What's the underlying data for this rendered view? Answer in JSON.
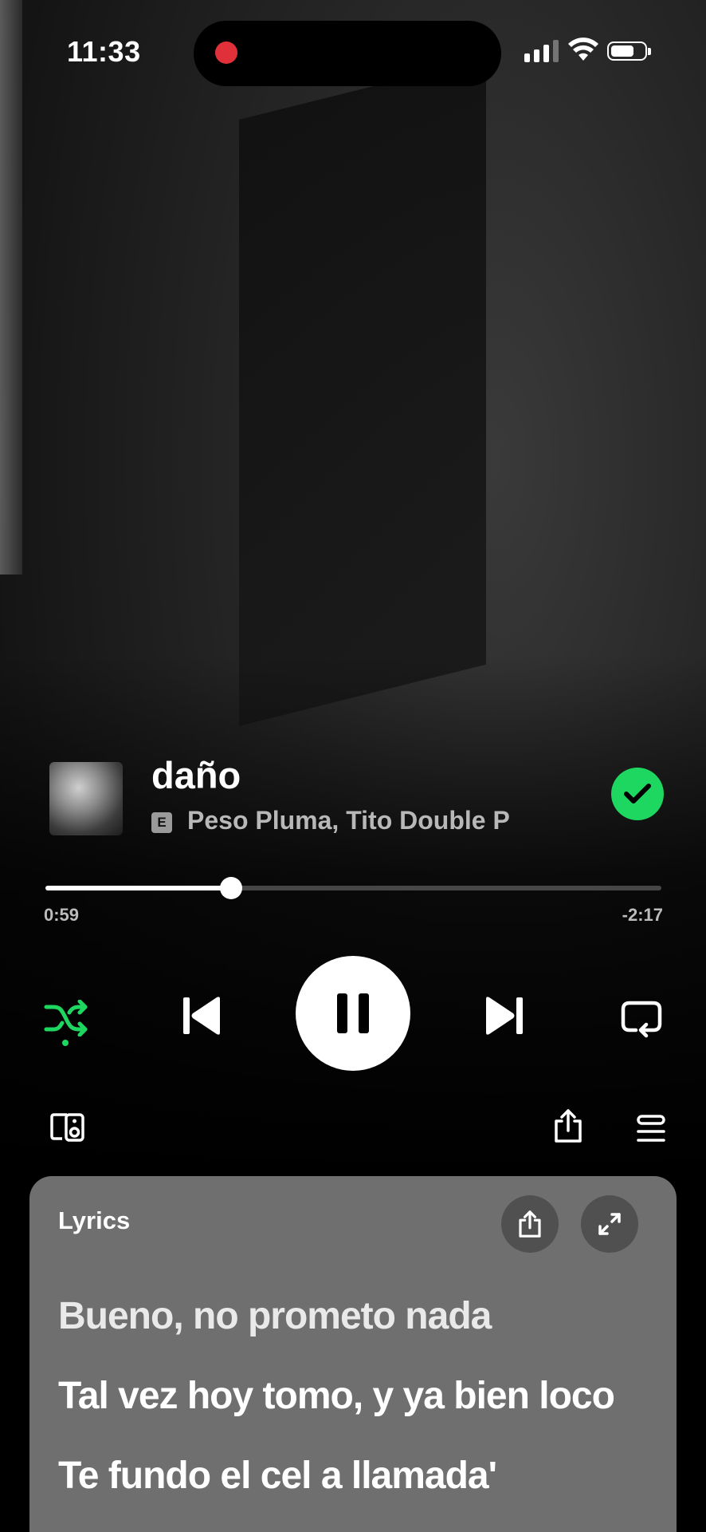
{
  "status_bar": {
    "time": "11:33"
  },
  "track": {
    "title": "daño",
    "explicit_badge": "E",
    "artists": "Peso Pluma, Tito Double P",
    "saved": true
  },
  "playback": {
    "elapsed": "0:59",
    "remaining": "-2:17",
    "progress_fraction": 0.302,
    "shuffle_active": true,
    "state": "playing"
  },
  "lyrics": {
    "label": "Lyrics",
    "lines": [
      "Bueno, no prometo nada",
      "Tal vez hoy tomo, y ya bien loco",
      "Te fundo el cel a llamada'"
    ]
  },
  "colors": {
    "accent_green": "#1ed760",
    "record_red": "#e0313a",
    "lyrics_card": "#6f6f6f"
  },
  "icons": {
    "shuffle": "shuffle-icon",
    "previous": "skip-previous-icon",
    "pause": "pause-icon",
    "next": "skip-next-icon",
    "repeat": "repeat-icon",
    "connect": "connect-device-icon",
    "share": "share-icon",
    "queue": "queue-icon",
    "expand": "expand-icon",
    "saved": "check-icon"
  }
}
